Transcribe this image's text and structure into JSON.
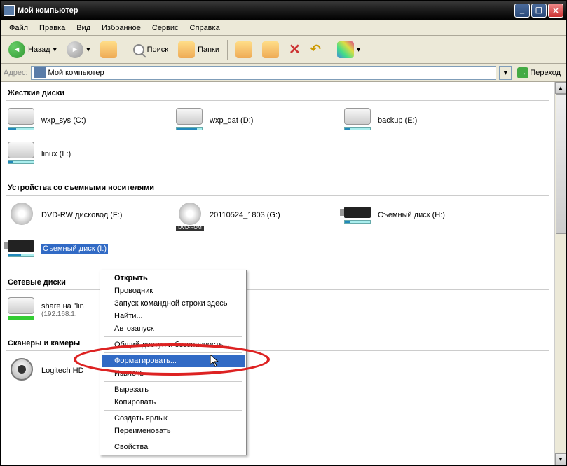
{
  "titlebar": {
    "title": "Мой компьютер"
  },
  "menubar": {
    "file": "Файл",
    "edit": "Правка",
    "view": "Вид",
    "favorites": "Избранное",
    "tools": "Сервис",
    "help": "Справка"
  },
  "toolbar": {
    "back": "Назад",
    "search": "Поиск",
    "folders": "Папки"
  },
  "addressbar": {
    "label": "Адрес:",
    "value": "Мой компьютер",
    "go": "Переход"
  },
  "sections": {
    "hdd": "Жесткие диски",
    "removable": "Устройства со съемными носителями",
    "network": "Сетевые диски",
    "scanners": "Сканеры и камеры"
  },
  "drives": {
    "hdd": [
      {
        "label": "wxp_sys (C:)"
      },
      {
        "label": "wxp_dat (D:)"
      },
      {
        "label": "backup (E:)"
      },
      {
        "label": "linux (L:)"
      }
    ],
    "removable": [
      {
        "label": "DVD-RW дисковод (F:)",
        "type": "dvd"
      },
      {
        "label": "20110524_1803 (G:)",
        "type": "dvdrom",
        "badge": "DVD-ROM"
      },
      {
        "label": "Съемный диск (H:)",
        "type": "usb"
      },
      {
        "label": "Съемный диск (I:)",
        "type": "usb",
        "selected": true
      }
    ],
    "network": [
      {
        "label": "share на \"lin",
        "sub": "(192.168.1."
      }
    ],
    "scanners": [
      {
        "label": "Logitech HD"
      }
    ]
  },
  "ctx": {
    "open": "Открыть",
    "explorer": "Проводник",
    "cmd": "Запуск командной строки здесь",
    "find": "Найти...",
    "autorun": "Автозапуск",
    "sharing": "Общий доступ и безопасность...",
    "format": "Форматировать...",
    "eject": "Извлечь",
    "cut": "Вырезать",
    "copy": "Копировать",
    "shortcut": "Создать ярлык",
    "rename": "Переименовать",
    "properties": "Свойства"
  }
}
